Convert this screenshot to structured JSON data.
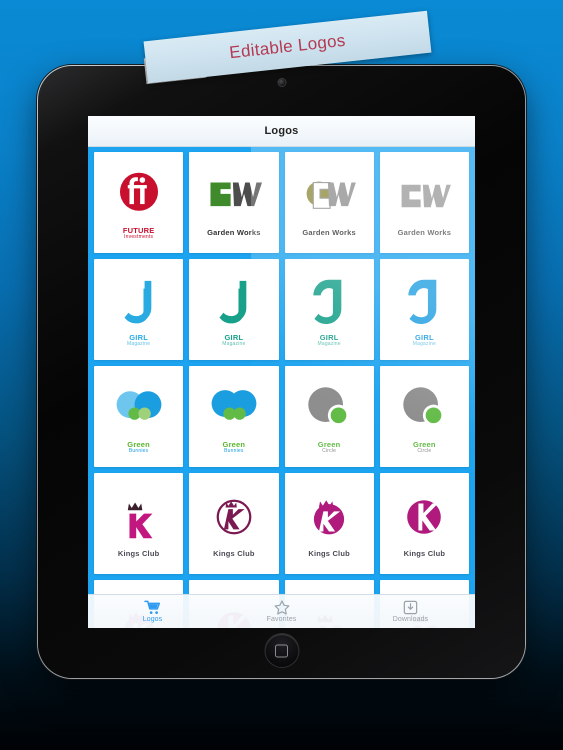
{
  "banner": {
    "text": "Editable Logos",
    "text_color": "#b33a52",
    "ribbon_color": "#cfe4f0"
  },
  "device": {
    "name": "tablet",
    "bezel_color": "#0a0a0a",
    "home_button": "home-button",
    "camera": "front-camera"
  },
  "app": {
    "navbar": {
      "title": "Logos"
    },
    "background_color": "#1ca4f0",
    "card_color": "#ffffff"
  },
  "grid": {
    "columns": 4,
    "cards": [
      {
        "id": "future-investments-1",
        "mark": "fi-circle",
        "line1": "FUTURE",
        "line2": "Investments",
        "color1": "#c8102e",
        "color2": "#c8102e",
        "l1_color": "#c8102e",
        "l2_color": "#c8102e"
      },
      {
        "id": "garden-works-1",
        "mark": "gw-split",
        "line1": "Garden Works",
        "line2": "",
        "color1": "#3f8a2b",
        "color2": "#4d4d4d",
        "l1_color": "#333333",
        "l2_color": "#777777"
      },
      {
        "id": "garden-works-2",
        "mark": "gw-olive",
        "line1": "Garden Works",
        "line2": "",
        "color1": "#8c8a3a",
        "color2": "#8e8e8e",
        "l1_color": "#333333",
        "l2_color": "#999999"
      },
      {
        "id": "garden-works-3",
        "mark": "gw-gray",
        "line1": "Garden Works",
        "line2": "",
        "color1": "#9a9a9a",
        "color2": "#9a9a9a",
        "l1_color": "#555555",
        "l2_color": "#888888"
      },
      {
        "id": "girl-magazine-1",
        "mark": "g-block",
        "line1": "GIRL",
        "line2": "Magazine",
        "color1": "#29abe2",
        "color2": "#29abe2",
        "l1_color": "#29abe2",
        "l2_color": "#5fc2e8"
      },
      {
        "id": "girl-magazine-2",
        "mark": "g-block",
        "line1": "GIRL",
        "line2": "Magazine",
        "color1": "#17a08a",
        "color2": "#17a08a",
        "l1_color": "#17a08a",
        "l2_color": "#5ec0b2"
      },
      {
        "id": "girl-magazine-3",
        "mark": "g-round",
        "line1": "GIRL",
        "line2": "Magazine",
        "color1": "#17a08a",
        "color2": "#17a08a",
        "l1_color": "#17a08a",
        "l2_color": "#5ec0b2"
      },
      {
        "id": "girl-magazine-4",
        "mark": "g-round",
        "line1": "GIRL",
        "line2": "Magazine",
        "color1": "#1f9ee0",
        "color2": "#1f9ee0",
        "l1_color": "#1f9ee0",
        "l2_color": "#6ec0e8"
      },
      {
        "id": "green-bunnies-1",
        "mark": "bunnies-light",
        "line1": "Green",
        "line2": "Bunnies",
        "color1": "#6ec6ef",
        "color2": "#1b9ee0",
        "l1_color": "#5cb531",
        "l2_color": "#1b9ee0"
      },
      {
        "id": "green-bunnies-2",
        "mark": "bunnies-solid",
        "line1": "Green",
        "line2": "Bunnies",
        "color1": "#1b9ee0",
        "color2": "#1b9ee0",
        "l1_color": "#5cb531",
        "l2_color": "#1b9ee0"
      },
      {
        "id": "green-circle-1",
        "mark": "greencircle",
        "line1": "Green",
        "line2": "Circle",
        "color1": "#8d8d8d",
        "color2": "#62bb46",
        "l1_color": "#62bb46",
        "l2_color": "#8d8d8d"
      },
      {
        "id": "green-circle-2",
        "mark": "greencircle",
        "line1": "Green",
        "line2": "Circle",
        "color1": "#8d8d8d",
        "color2": "#62bb46",
        "l1_color": "#62bb46",
        "l2_color": "#8d8d8d"
      },
      {
        "id": "kings-club-1",
        "mark": "k-crown",
        "line1": "Kings Club",
        "line2": "",
        "color1": "#c2177f",
        "color2": "#3b1f2b",
        "l1_color": "#4a4a55",
        "l2_color": "#888888"
      },
      {
        "id": "kings-club-2",
        "mark": "k-ring",
        "line1": "Kings Club",
        "line2": "",
        "color1": "#7b1a52",
        "color2": "#7b1a52",
        "l1_color": "#4a4a55",
        "l2_color": "#888888"
      },
      {
        "id": "kings-club-3",
        "mark": "k-filled-crown",
        "line1": "Kings Club",
        "line2": "",
        "color1": "#b01a7d",
        "color2": "#b01a7d",
        "l1_color": "#4a4a55",
        "l2_color": "#888888"
      },
      {
        "id": "kings-club-4",
        "mark": "k-cut",
        "line1": "Kings Club",
        "line2": "",
        "color1": "#b01a7d",
        "color2": "#b01a7d",
        "l1_color": "#4a4a55",
        "l2_color": "#888888"
      },
      {
        "id": "kings-club-5",
        "mark": "k-filled-crown",
        "line1": "",
        "line2": "",
        "color1": "#b01a7d",
        "color2": "#b01a7d",
        "l1_color": "#4a4a55",
        "l2_color": "#888888"
      },
      {
        "id": "kings-club-6",
        "mark": "k-cut",
        "line1": "",
        "line2": "",
        "color1": "#b01a7d",
        "color2": "#b01a7d",
        "l1_color": "#4a4a55",
        "l2_color": "#888888"
      },
      {
        "id": "kings-club-7",
        "mark": "k-crown",
        "line1": "",
        "line2": "",
        "color1": "#b01a7d",
        "color2": "#3b1f2b",
        "l1_color": "#4a4a55",
        "l2_color": "#888888"
      },
      {
        "id": "kings-club-8",
        "mark": "k-crown",
        "line1": "",
        "line2": "",
        "color1": "#b01a7d",
        "color2": "#3b1f2b",
        "l1_color": "#4a4a55",
        "l2_color": "#888888"
      }
    ]
  },
  "tabbar": {
    "active_color": "#2e9bf0",
    "inactive_color": "#9aa3ab",
    "tabs": [
      {
        "id": "logos",
        "label": "Logos",
        "icon": "shopping-cart-icon",
        "active": true
      },
      {
        "id": "favorites",
        "label": "Favorites",
        "icon": "star-icon",
        "active": false
      },
      {
        "id": "downloads",
        "label": "Downloads",
        "icon": "download-icon",
        "active": false
      }
    ]
  }
}
